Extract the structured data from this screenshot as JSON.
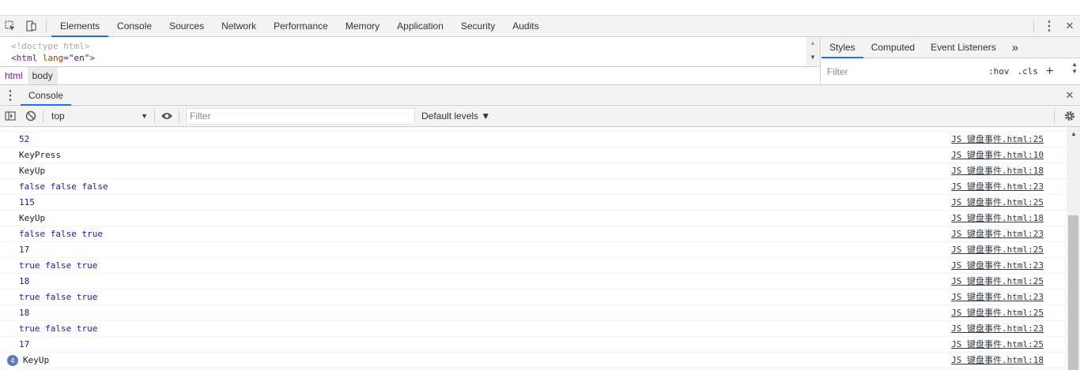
{
  "toolbar": {
    "tabs": [
      "Elements",
      "Console",
      "Sources",
      "Network",
      "Performance",
      "Memory",
      "Application",
      "Security",
      "Audits"
    ],
    "active_tab": "Elements",
    "menu_glyph": "⋮",
    "close_glyph": "✕"
  },
  "elements": {
    "doctype": "<!doctype html>",
    "html_open_tag": "html",
    "html_attr_name": "lang",
    "html_attr_value": "\"en\"",
    "breadcrumbs": [
      "html",
      "body"
    ]
  },
  "styles": {
    "tabs": [
      "Styles",
      "Computed",
      "Event Listeners"
    ],
    "more_glyph": "»",
    "filter_placeholder": "Filter",
    "hov": ":hov",
    "cls": ".cls",
    "plus": "+"
  },
  "drawer": {
    "tab": "Console",
    "close_glyph": "✕"
  },
  "console": {
    "context": "top",
    "filter_placeholder": "Filter",
    "levels": "Default levels ▼",
    "messages": [
      {
        "text": "52",
        "kind": "num",
        "src": "JS 键盘事件.html:25"
      },
      {
        "text": "KeyPress",
        "kind": "str",
        "src": "JS 键盘事件.html:10"
      },
      {
        "text": "KeyUp",
        "kind": "str",
        "src": "JS 键盘事件.html:18"
      },
      {
        "text": "false false false",
        "kind": "bool",
        "src": "JS 键盘事件.html:23"
      },
      {
        "text": "115",
        "kind": "num",
        "src": "JS 键盘事件.html:25"
      },
      {
        "text": "KeyUp",
        "kind": "str",
        "src": "JS 键盘事件.html:18"
      },
      {
        "text": "false false true",
        "kind": "bool",
        "src": "JS 键盘事件.html:23"
      },
      {
        "text": "17",
        "kind": "num",
        "src": "JS 键盘事件.html:25"
      },
      {
        "text": "true false true",
        "kind": "bool",
        "src": "JS 键盘事件.html:23"
      },
      {
        "text": "18",
        "kind": "num",
        "src": "JS 键盘事件.html:25"
      },
      {
        "text": "true false true",
        "kind": "bool",
        "src": "JS 键盘事件.html:23"
      },
      {
        "text": "18",
        "kind": "num",
        "src": "JS 键盘事件.html:25"
      },
      {
        "text": "true false true",
        "kind": "bool",
        "src": "JS 键盘事件.html:23"
      },
      {
        "text": "17",
        "kind": "num",
        "src": "JS 键盘事件.html:25"
      },
      {
        "text": "KeyUp",
        "kind": "str",
        "src": "JS 键盘事件.html:18",
        "repeat": "4"
      }
    ]
  },
  "colors": {
    "accent": "#1a73e8",
    "tag": "#881280",
    "value": "#1a1aa6",
    "badge": "#5d7bb6"
  }
}
